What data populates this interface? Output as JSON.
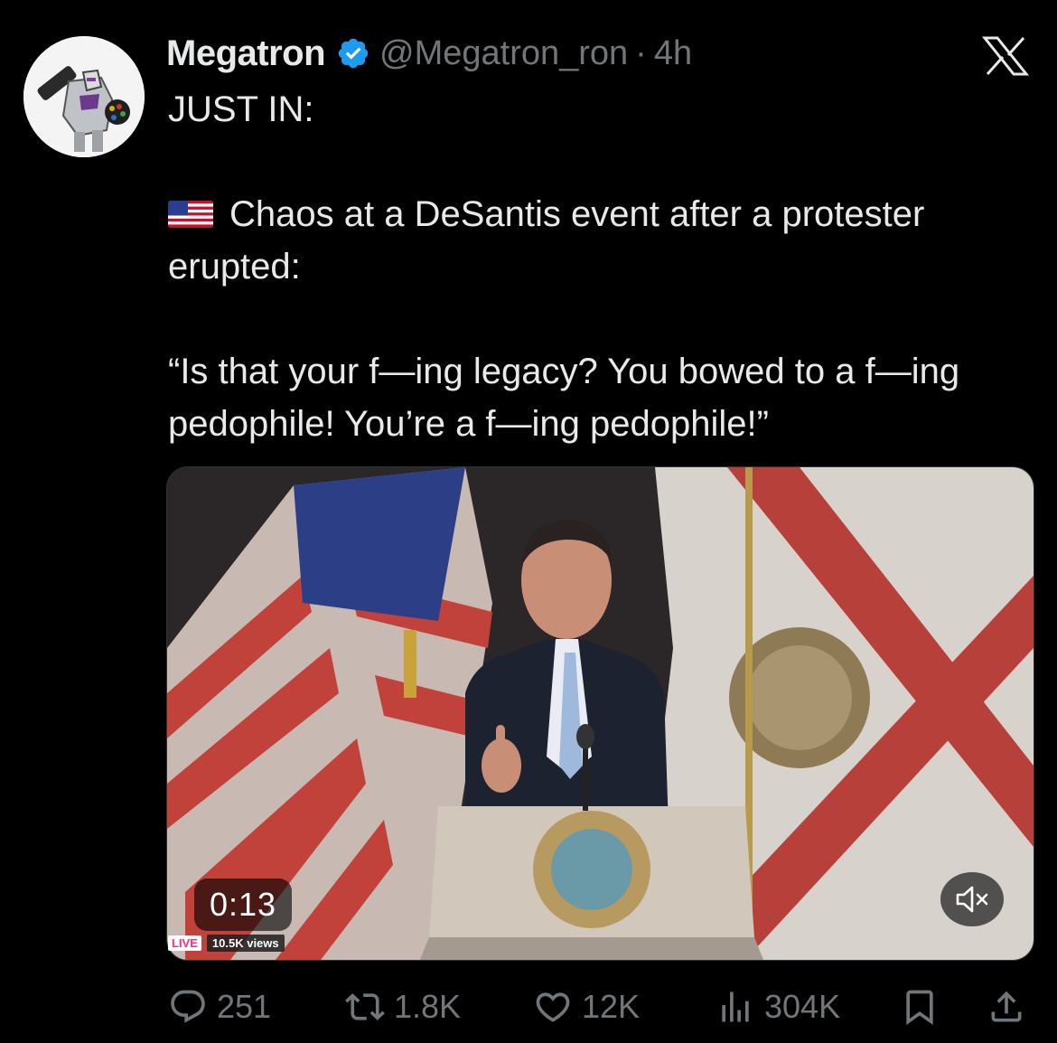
{
  "author": {
    "display_name": "Megatron",
    "handle": "@Megatron_ron",
    "separator": "·",
    "time": "4h",
    "avatar_icon": "megatron-avatar",
    "verified_icon": "verified-badge-icon",
    "verified_color": "#1d9bf0"
  },
  "brand_icon": "x-logo-icon",
  "tweet": {
    "line1": "JUST IN:",
    "flag_icon": "us-flag-emoji",
    "line2": "Chaos at a DeSantis event after a protester erupted:",
    "quote": "“Is that your f—ing legacy? You bowed to a f—ing pedophile! You’re a f—ing pedophile!”"
  },
  "video": {
    "duration": "0:13",
    "live_label": "LIVE",
    "views": "10.5K views",
    "mute_icon": "speaker-muted-icon"
  },
  "actions": {
    "replies": "251",
    "reposts": "1.8K",
    "likes": "12K",
    "views": "304K",
    "reply_icon": "reply-icon",
    "repost_icon": "repost-icon",
    "like_icon": "heart-icon",
    "views_icon": "analytics-icon",
    "bookmark_icon": "bookmark-icon",
    "share_icon": "share-icon"
  },
  "colors": {
    "background": "#000000",
    "text": "#e7e9ea",
    "muted": "#71767b",
    "accent": "#1d9bf0"
  }
}
